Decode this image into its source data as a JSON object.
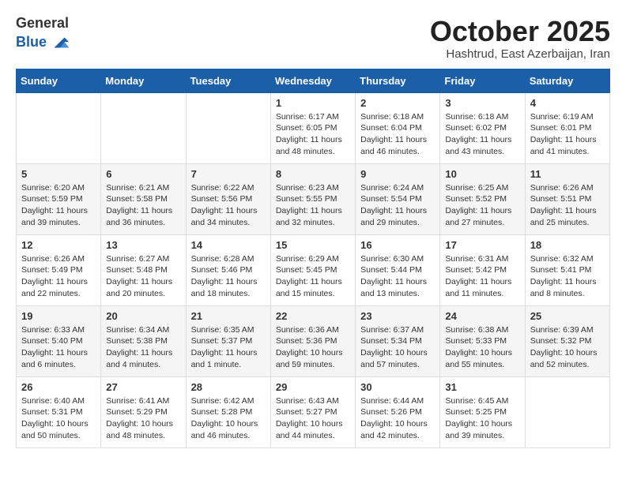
{
  "header": {
    "logo": {
      "line1": "General",
      "line2": "Blue"
    },
    "title": "October 2025",
    "location": "Hashtrud, East Azerbaijan, Iran"
  },
  "days_of_week": [
    "Sunday",
    "Monday",
    "Tuesday",
    "Wednesday",
    "Thursday",
    "Friday",
    "Saturday"
  ],
  "weeks": [
    [
      {
        "day": "",
        "info": ""
      },
      {
        "day": "",
        "info": ""
      },
      {
        "day": "",
        "info": ""
      },
      {
        "day": "1",
        "info": "Sunrise: 6:17 AM\nSunset: 6:05 PM\nDaylight: 11 hours and 48 minutes."
      },
      {
        "day": "2",
        "info": "Sunrise: 6:18 AM\nSunset: 6:04 PM\nDaylight: 11 hours and 46 minutes."
      },
      {
        "day": "3",
        "info": "Sunrise: 6:18 AM\nSunset: 6:02 PM\nDaylight: 11 hours and 43 minutes."
      },
      {
        "day": "4",
        "info": "Sunrise: 6:19 AM\nSunset: 6:01 PM\nDaylight: 11 hours and 41 minutes."
      }
    ],
    [
      {
        "day": "5",
        "info": "Sunrise: 6:20 AM\nSunset: 5:59 PM\nDaylight: 11 hours and 39 minutes."
      },
      {
        "day": "6",
        "info": "Sunrise: 6:21 AM\nSunset: 5:58 PM\nDaylight: 11 hours and 36 minutes."
      },
      {
        "day": "7",
        "info": "Sunrise: 6:22 AM\nSunset: 5:56 PM\nDaylight: 11 hours and 34 minutes."
      },
      {
        "day": "8",
        "info": "Sunrise: 6:23 AM\nSunset: 5:55 PM\nDaylight: 11 hours and 32 minutes."
      },
      {
        "day": "9",
        "info": "Sunrise: 6:24 AM\nSunset: 5:54 PM\nDaylight: 11 hours and 29 minutes."
      },
      {
        "day": "10",
        "info": "Sunrise: 6:25 AM\nSunset: 5:52 PM\nDaylight: 11 hours and 27 minutes."
      },
      {
        "day": "11",
        "info": "Sunrise: 6:26 AM\nSunset: 5:51 PM\nDaylight: 11 hours and 25 minutes."
      }
    ],
    [
      {
        "day": "12",
        "info": "Sunrise: 6:26 AM\nSunset: 5:49 PM\nDaylight: 11 hours and 22 minutes."
      },
      {
        "day": "13",
        "info": "Sunrise: 6:27 AM\nSunset: 5:48 PM\nDaylight: 11 hours and 20 minutes."
      },
      {
        "day": "14",
        "info": "Sunrise: 6:28 AM\nSunset: 5:46 PM\nDaylight: 11 hours and 18 minutes."
      },
      {
        "day": "15",
        "info": "Sunrise: 6:29 AM\nSunset: 5:45 PM\nDaylight: 11 hours and 15 minutes."
      },
      {
        "day": "16",
        "info": "Sunrise: 6:30 AM\nSunset: 5:44 PM\nDaylight: 11 hours and 13 minutes."
      },
      {
        "day": "17",
        "info": "Sunrise: 6:31 AM\nSunset: 5:42 PM\nDaylight: 11 hours and 11 minutes."
      },
      {
        "day": "18",
        "info": "Sunrise: 6:32 AM\nSunset: 5:41 PM\nDaylight: 11 hours and 8 minutes."
      }
    ],
    [
      {
        "day": "19",
        "info": "Sunrise: 6:33 AM\nSunset: 5:40 PM\nDaylight: 11 hours and 6 minutes."
      },
      {
        "day": "20",
        "info": "Sunrise: 6:34 AM\nSunset: 5:38 PM\nDaylight: 11 hours and 4 minutes."
      },
      {
        "day": "21",
        "info": "Sunrise: 6:35 AM\nSunset: 5:37 PM\nDaylight: 11 hours and 1 minute."
      },
      {
        "day": "22",
        "info": "Sunrise: 6:36 AM\nSunset: 5:36 PM\nDaylight: 10 hours and 59 minutes."
      },
      {
        "day": "23",
        "info": "Sunrise: 6:37 AM\nSunset: 5:34 PM\nDaylight: 10 hours and 57 minutes."
      },
      {
        "day": "24",
        "info": "Sunrise: 6:38 AM\nSunset: 5:33 PM\nDaylight: 10 hours and 55 minutes."
      },
      {
        "day": "25",
        "info": "Sunrise: 6:39 AM\nSunset: 5:32 PM\nDaylight: 10 hours and 52 minutes."
      }
    ],
    [
      {
        "day": "26",
        "info": "Sunrise: 6:40 AM\nSunset: 5:31 PM\nDaylight: 10 hours and 50 minutes."
      },
      {
        "day": "27",
        "info": "Sunrise: 6:41 AM\nSunset: 5:29 PM\nDaylight: 10 hours and 48 minutes."
      },
      {
        "day": "28",
        "info": "Sunrise: 6:42 AM\nSunset: 5:28 PM\nDaylight: 10 hours and 46 minutes."
      },
      {
        "day": "29",
        "info": "Sunrise: 6:43 AM\nSunset: 5:27 PM\nDaylight: 10 hours and 44 minutes."
      },
      {
        "day": "30",
        "info": "Sunrise: 6:44 AM\nSunset: 5:26 PM\nDaylight: 10 hours and 42 minutes."
      },
      {
        "day": "31",
        "info": "Sunrise: 6:45 AM\nSunset: 5:25 PM\nDaylight: 10 hours and 39 minutes."
      },
      {
        "day": "",
        "info": ""
      }
    ]
  ]
}
